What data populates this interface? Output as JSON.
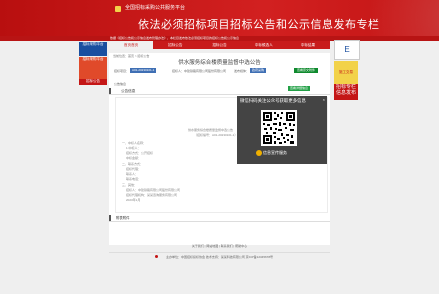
{
  "header": {
    "logo_text": "全国招标采购公共服务平台",
    "title": "依法必须招标项目招标公告和公示信息发布专栏",
    "subline": "依据《招标公告和公示信息发布管理办法》，本栏目发布依法必须招标项目的招标公告和公示信息"
  },
  "nav": {
    "tabs": [
      {
        "label": "首页首页",
        "active": true
      },
      {
        "label": "招标公告",
        "active": false
      },
      {
        "label": "招标公告",
        "active": false
      },
      {
        "label": "中标候选人",
        "active": false
      },
      {
        "label": "中标结果",
        "active": false
      }
    ]
  },
  "ads": {
    "left1": "招标采购平台",
    "left2": "招标采购平台",
    "left3": "招标公告",
    "right1": "E",
    "right2": "施工交易",
    "right3a": "招标专栏",
    "right3b": "信息发布"
  },
  "breadcrumb": "当前位置：首页 > 招标公告",
  "doc": {
    "title": "供水服务综合楼质量监督中选公告",
    "meta_label1": "招标项目：",
    "meta_val1": "A01-20230101-1",
    "meta_label2": "招标人：中建铁路有限公司股份有限公司",
    "meta_label3": "发布媒体：",
    "meta_val3": "政府采购",
    "meta_btn": "查看原文附件",
    "announce": "公告信息",
    "section_notice": "公告信息",
    "section_table": "附表附件",
    "green_btn": "查看详细信息",
    "lines": [
      "供水服务综合楼质量监督中选公告",
      "（招标编号：A01-20230101-1）",
      "一、中标人名称：",
      "1.中标人：",
      "招标方式：公开招标",
      "中标金额：",
      "二、联系方式：",
      "招标代理：",
      "联系人：",
      "联系电话：",
      "三、其他：",
      "招标人：中建铁路有限公司股份有限公司",
      "招标代理机构：某某咨询服务有限公司",
      "2023年1月"
    ]
  },
  "modal": {
    "title": "微信扫码关注公众号获取更多信息",
    "close": "×",
    "brand": "信息宣传服务"
  },
  "footer": {
    "links": "关于我们  |  网站地图  |  联系我们  |  帮助中心",
    "copyright": "主办单位：中国招标投标协会   技术支持：某某科技有限公司   京ICP备12345678号"
  }
}
